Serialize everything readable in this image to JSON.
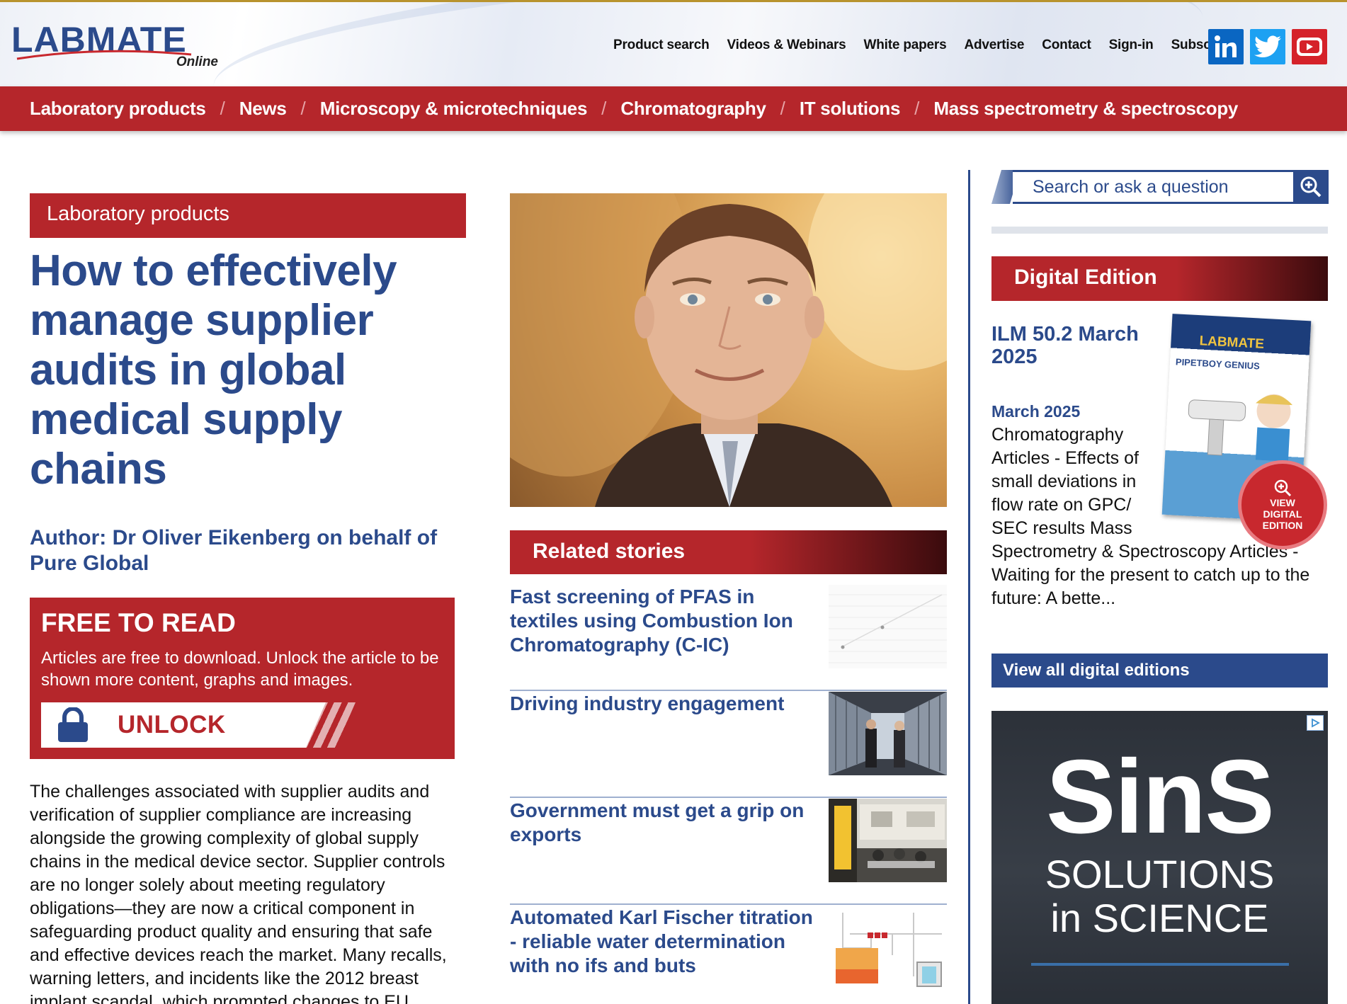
{
  "header": {
    "logo_text": "LABMATE",
    "logo_sub": "Online",
    "nav": [
      "Product search",
      "Videos & Webinars",
      "White papers",
      "Advertise",
      "Contact",
      "Sign-in",
      "Subscribe"
    ],
    "social": [
      "linkedin",
      "twitter",
      "youtube"
    ]
  },
  "category_nav": {
    "items": [
      "Laboratory products",
      "News",
      "Microscopy & microtechniques",
      "Chromatography",
      "IT solutions",
      "Mass spectrometry & spectroscopy"
    ],
    "separator": "/"
  },
  "article": {
    "category": "Laboratory products",
    "title": "How to effectively manage supplier audits in global medical supply chains",
    "author": "Author: Dr Oliver Eikenberg on behalf of Pure Global",
    "free_box": {
      "title": "FREE TO READ",
      "text": "Articles are free to download. Unlock the article to be shown more content, graphs and images.",
      "unlock_label": "UNLOCK"
    },
    "body": "The challenges associated with supplier audits and verification of supplier compliance are increasing alongside the growing complexity of global supply chains in the medical device sector. Supplier controls are no longer solely about meeting regulatory obligations—they are now a critical component in safeguarding product quality and ensuring that safe and effective devices reach the market. Many recalls, warning letters, and incidents like the 2012 breast implant scandal, which prompted changes to EU"
  },
  "related": {
    "heading": "Related stories",
    "stories": [
      {
        "title": "Fast screening of PFAS in textiles using Combustion Ion Chromatography (C-IC)"
      },
      {
        "title": "Driving industry engagement"
      },
      {
        "title": "Government must get a grip on exports"
      },
      {
        "title": "Automated Karl Fischer titration - reliable water determination with no ifs and buts"
      }
    ]
  },
  "sidebar": {
    "search_placeholder": "Search or ask a question",
    "digital_edition": {
      "heading": "Digital Edition",
      "title": "ILM 50.2 March 2025",
      "date": "March 2025",
      "desc_narrow": [
        "Chromatography",
        "Articles - Effects of",
        "small deviations in",
        "flow rate on GPC/",
        "SEC results Mass"
      ],
      "desc_wide": "Spectrometry & Spectroscopy Articles - Waiting for the present to catch up to the future: A bette...",
      "cover_title": "LABMATE",
      "cover_sub": "PIPETBOY GENIUS",
      "view_badge": [
        "VIEW",
        "DIGITAL",
        "EDITION"
      ],
      "view_all": "View all digital editions"
    },
    "ad": {
      "big": "SinS",
      "line1": "SOLUTIONS",
      "line2": "in SCIENCE"
    }
  },
  "colors": {
    "brand_red": "#b5262b",
    "brand_blue": "#2b4a8b"
  }
}
